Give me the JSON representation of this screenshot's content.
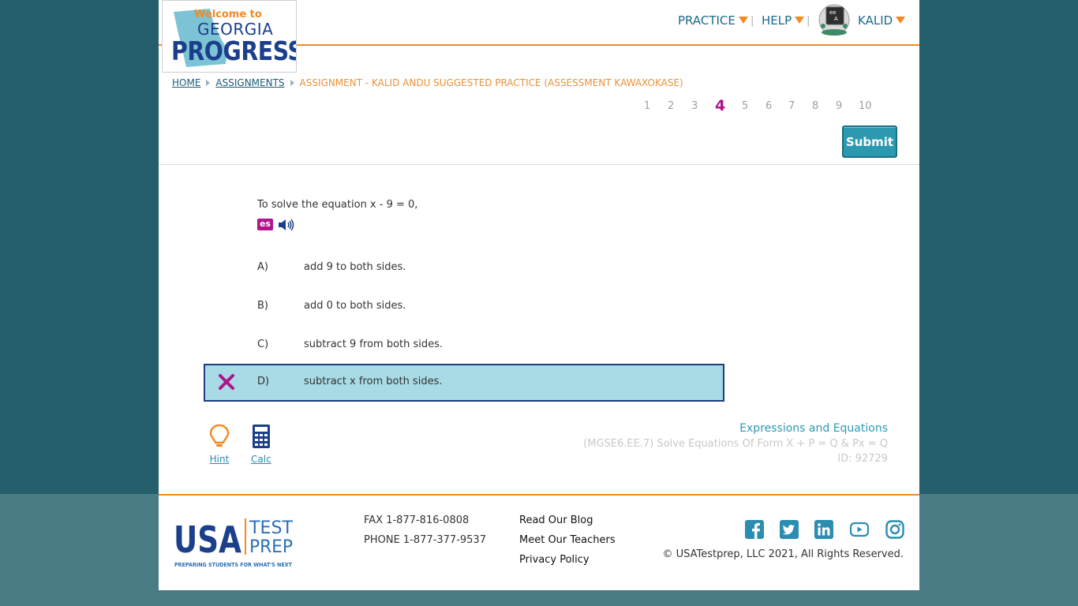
{
  "logo": {
    "welcome": "Welcome to",
    "state": "GEORGIA",
    "brand": "PROGRESS"
  },
  "nav": {
    "practice": "PRACTICE",
    "help": "HELP",
    "user": "KALID",
    "separator": "|"
  },
  "breadcrumb": {
    "home": "HOME",
    "assignments": "ASSIGNMENTS",
    "current": "ASSIGNMENT - KALID ANDU SUGGESTED PRACTICE (ASSESSMENT KAWAXOKASE)"
  },
  "pager": {
    "pages": [
      "1",
      "2",
      "3",
      "4",
      "5",
      "6",
      "7",
      "8",
      "9",
      "10"
    ],
    "current": "4"
  },
  "submit_label": "Submit",
  "question": {
    "prompt": "To solve the equation x - 9 = 0,",
    "es_label": "es",
    "choices": [
      {
        "letter": "A)",
        "text": "add 9 to both sides."
      },
      {
        "letter": "B)",
        "text": "add 0 to both sides."
      },
      {
        "letter": "C)",
        "text": "subtract 9 from both sides."
      },
      {
        "letter": "D)",
        "text": "subtract x from both sides."
      }
    ],
    "selected": "D)",
    "selected_status": "incorrect"
  },
  "tools": {
    "hint": "Hint",
    "calc": "Calc"
  },
  "meta": {
    "subject": "Expressions and Equations",
    "standard": "(MGSE6.EE.7) Solve Equations Of Form X + P = Q & Px = Q",
    "id": "ID: 92729"
  },
  "footer": {
    "logo_usa": "USA",
    "logo_test": "TEST",
    "logo_prep": "PREP",
    "tagline": "PREPARING STUDENTS FOR WHAT'S NEXT",
    "fax": "FAX 1-877-816-0808",
    "phone": "PHONE 1-877-377-9537",
    "links": [
      "Read Our Blog",
      "Meet Our Teachers",
      "Privacy Policy"
    ],
    "social_icons": [
      "facebook-icon",
      "twitter-icon",
      "linkedin-icon",
      "youtube-icon",
      "instagram-icon"
    ],
    "copyright": "© USATestprep, LLC 2021, All Rights Reserved."
  },
  "colors": {
    "background": "#245e6a",
    "accent_orange": "#f08a24",
    "brand_blue": "#1b3f8b",
    "teal": "#2b9ab1",
    "selected_fill": "#a8dbe5",
    "wrong_mark": "#b0148b"
  }
}
